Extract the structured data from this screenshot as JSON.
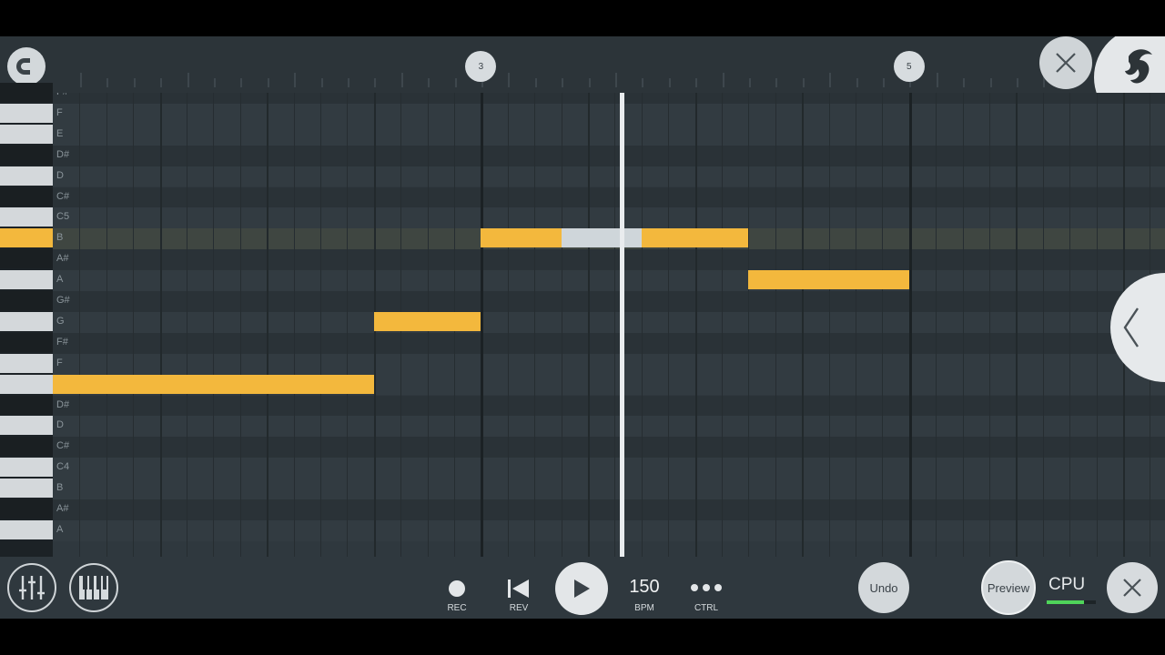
{
  "timeline": {
    "markers": [
      {
        "label": "3",
        "beat": 16
      },
      {
        "label": "5",
        "beat": 32
      }
    ]
  },
  "piano_roll": {
    "rows": [
      {
        "label": "F#",
        "type": "black"
      },
      {
        "label": "F",
        "type": "white"
      },
      {
        "label": "E",
        "type": "white"
      },
      {
        "label": "D#",
        "type": "black"
      },
      {
        "label": "D",
        "type": "white"
      },
      {
        "label": "C#",
        "type": "black"
      },
      {
        "label": "C5",
        "type": "white"
      },
      {
        "label": "B",
        "type": "white",
        "highlight": true
      },
      {
        "label": "A#",
        "type": "black"
      },
      {
        "label": "A",
        "type": "white"
      },
      {
        "label": "G#",
        "type": "black"
      },
      {
        "label": "G",
        "type": "white"
      },
      {
        "label": "F#",
        "type": "black"
      },
      {
        "label": "F",
        "type": "white"
      },
      {
        "label": "",
        "type": "white"
      },
      {
        "label": "D#",
        "type": "black"
      },
      {
        "label": "D",
        "type": "white"
      },
      {
        "label": "C#",
        "type": "black"
      },
      {
        "label": "C4",
        "type": "white"
      },
      {
        "label": "B",
        "type": "white"
      },
      {
        "label": "A#",
        "type": "black"
      },
      {
        "label": "A",
        "type": "white"
      }
    ],
    "notes": [
      {
        "row": 14,
        "start": 0,
        "length": 12,
        "selected": false
      },
      {
        "row": 11,
        "start": 12,
        "length": 4,
        "selected": false
      },
      {
        "row": 7,
        "start": 16,
        "length": 3,
        "selected": false
      },
      {
        "row": 7,
        "start": 19,
        "length": 3,
        "selected": true
      },
      {
        "row": 7,
        "start": 22,
        "length": 4,
        "selected": false
      },
      {
        "row": 9,
        "start": 26,
        "length": 6,
        "selected": false
      }
    ],
    "playhead_beat": 21.2
  },
  "transport": {
    "rec_label": "REC",
    "rev_label": "REV",
    "bpm_value": "150",
    "bpm_label": "BPM",
    "ctrl_label": "CTRL",
    "undo_label": "Undo",
    "preview_label": "Preview",
    "cpu_label": "CPU",
    "cpu_level": 0.75
  },
  "colors": {
    "note": "#f3b83d",
    "note_selected": "#cfd6da",
    "background": "#2f383e"
  }
}
